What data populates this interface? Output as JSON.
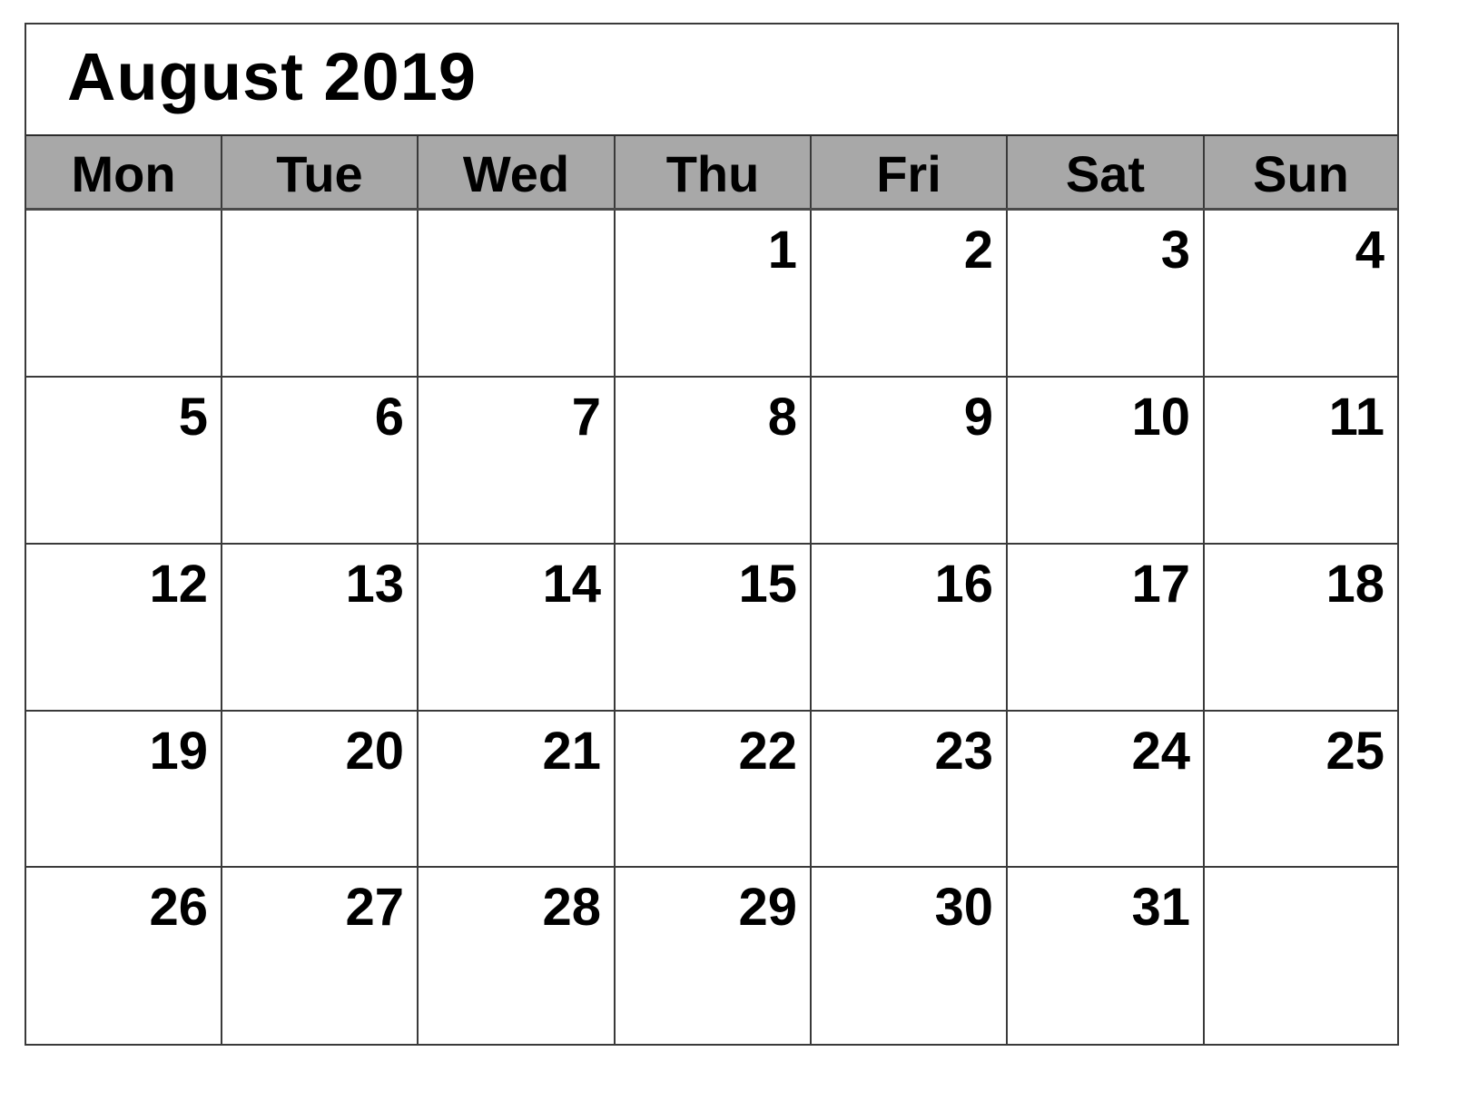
{
  "calendar": {
    "title": "August 2019",
    "month": "August",
    "year": "2019",
    "weekdays": [
      "Mon",
      "Tue",
      "Wed",
      "Thu",
      "Fri",
      "Sat",
      "Sun"
    ],
    "weeks": [
      [
        "",
        "",
        "",
        "1",
        "2",
        "3",
        "4"
      ],
      [
        "5",
        "6",
        "7",
        "8",
        "9",
        "10",
        "11"
      ],
      [
        "12",
        "13",
        "14",
        "15",
        "16",
        "17",
        "18"
      ],
      [
        "19",
        "20",
        "21",
        "22",
        "23",
        "24",
        "25"
      ],
      [
        "26",
        "27",
        "28",
        "29",
        "30",
        "31",
        ""
      ]
    ]
  },
  "colors": {
    "header_fill": "#a8a8a8",
    "grid_line": "#3a3a3a",
    "text": "#000000",
    "background": "#ffffff"
  }
}
